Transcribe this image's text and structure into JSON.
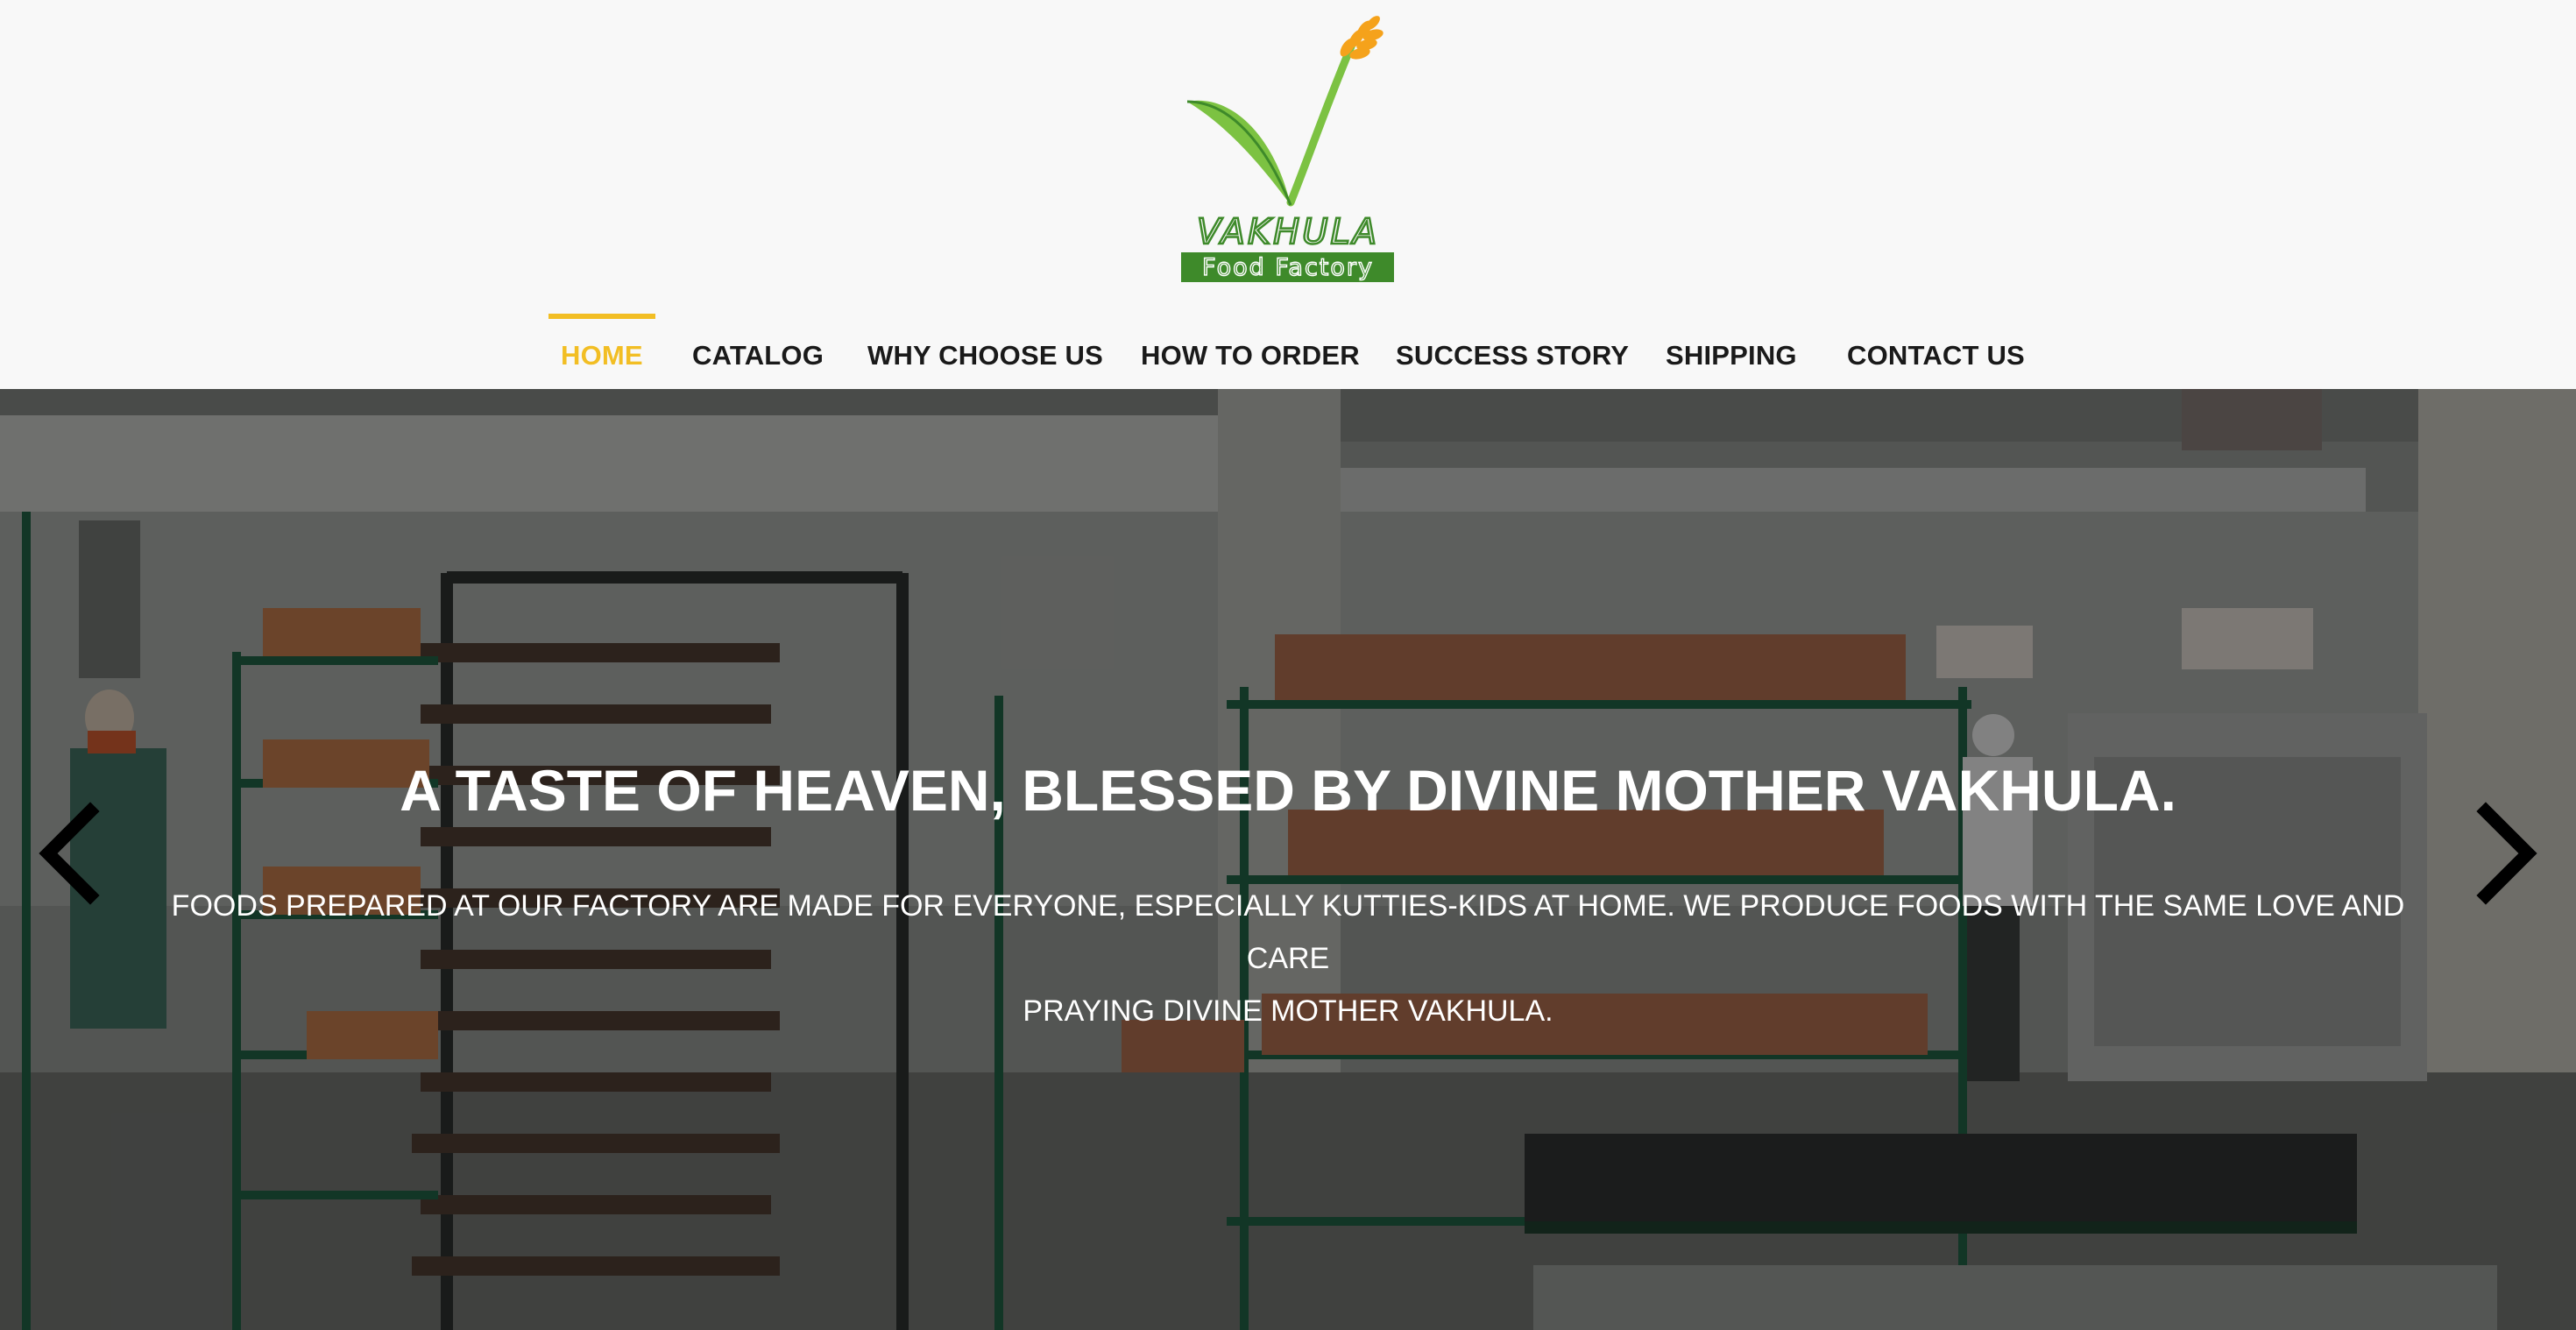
{
  "brand": {
    "name": "VAKHULA",
    "tagline": "Food Factory",
    "colors": {
      "leaf_green": "#7cc242",
      "leaf_dark": "#3e8a2a",
      "wheat_orange": "#f5a21b",
      "accent_yellow": "#f2be24"
    }
  },
  "nav": {
    "items": [
      {
        "label": "HOME",
        "active": true
      },
      {
        "label": "CATALOG",
        "active": false
      },
      {
        "label": "WHY CHOOSE US",
        "active": false
      },
      {
        "label": "HOW TO ORDER",
        "active": false
      },
      {
        "label": "SUCCESS STORY",
        "active": false
      },
      {
        "label": "SHIPPING",
        "active": false
      },
      {
        "label": "CONTACT US",
        "active": false
      }
    ]
  },
  "hero": {
    "title": "A TASTE OF HEAVEN, BLESSED BY DIVINE MOTHER VAKHULA.",
    "subtitle_line1": "FOODS PREPARED AT OUR FACTORY ARE MADE FOR EVERYONE, ESPECIALLY KUTTIES-KIDS AT HOME. WE PRODUCE FOODS WITH THE SAME LOVE AND CARE",
    "subtitle_line2": "PRAYING DIVINE MOTHER VAKHULA.",
    "prev_icon": "chevron-left-icon",
    "next_icon": "chevron-right-icon"
  }
}
